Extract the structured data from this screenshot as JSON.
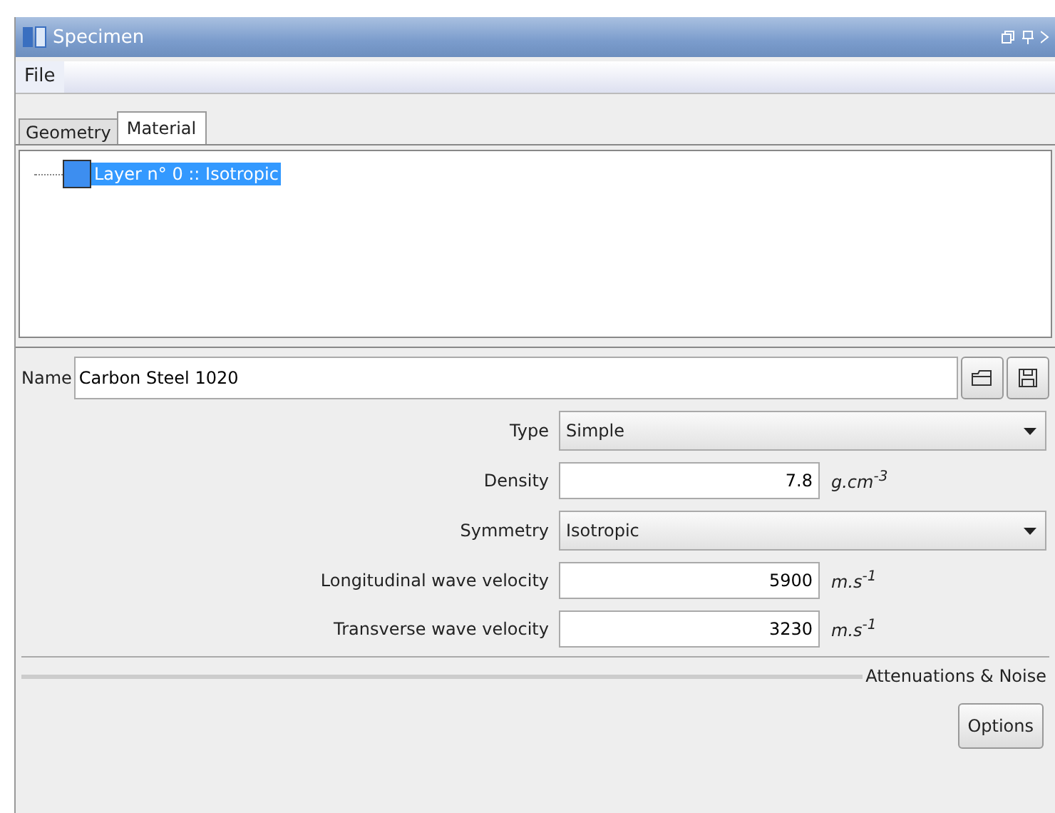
{
  "window": {
    "title": "Specimen"
  },
  "menu": [
    "File"
  ],
  "tabs": [
    {
      "label": "Geometry",
      "selected": false
    },
    {
      "label": "Material",
      "selected": true
    }
  ],
  "tree": [
    {
      "label": "Layer n° 0 :: Isotropic",
      "selected": true
    }
  ],
  "name_field": {
    "label": "Name",
    "value": "Carbon Steel 1020"
  },
  "fields": [
    {
      "kind": "select",
      "label": "Type",
      "value": "Simple"
    },
    {
      "kind": "number",
      "label": "Density",
      "value": "7.8",
      "unit": "g.cm$^{-3}$"
    },
    {
      "kind": "select",
      "label": "Symmetry",
      "value": "Isotropic"
    },
    {
      "kind": "number",
      "label": "Longitudinal wave velocity",
      "value": "5900",
      "unit": "m.s$^{-1}$"
    },
    {
      "kind": "number",
      "label": "Transverse wave velocity",
      "value": "3230",
      "unit": "m.s$^{-1}$"
    }
  ],
  "section": {
    "title": "Attenuations & Noise",
    "button": "Options"
  }
}
